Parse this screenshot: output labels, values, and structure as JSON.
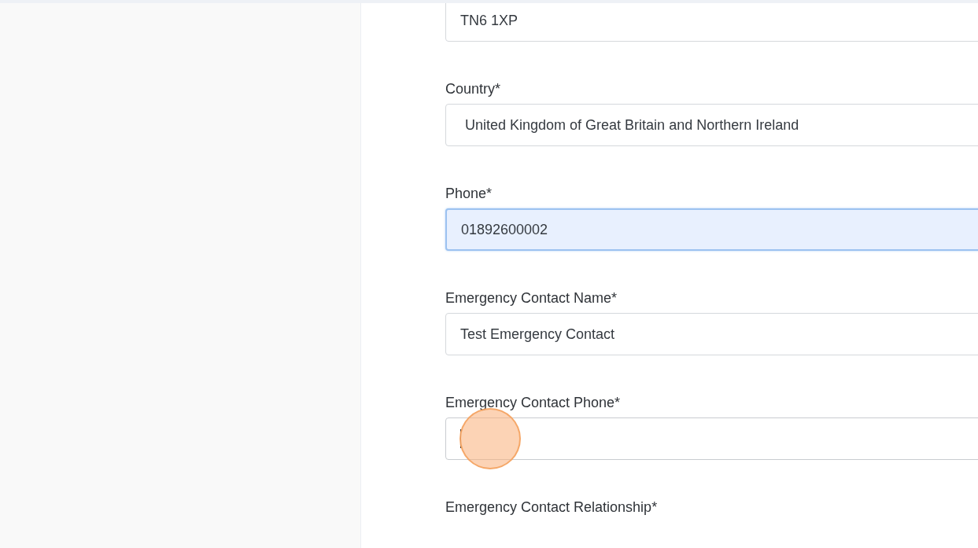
{
  "form": {
    "fields": [
      {
        "value": "TN6 1XP",
        "autofilled": false,
        "focused": false
      },
      {
        "label": "Country*",
        "value": "United Kingdom of Great Britain and Northern Ireland",
        "autofilled": false,
        "focused": false
      },
      {
        "label": "Phone*",
        "value": "01892600002",
        "autofilled": true,
        "focused": false
      },
      {
        "label": "Emergency Contact Name*",
        "value": "Test Emergency Contact",
        "autofilled": false,
        "focused": false
      },
      {
        "label": "Emergency Contact Phone*",
        "autofilled": false,
        "focused": true
      }
    ],
    "next_label": "Emergency Contact Relationship*"
  }
}
